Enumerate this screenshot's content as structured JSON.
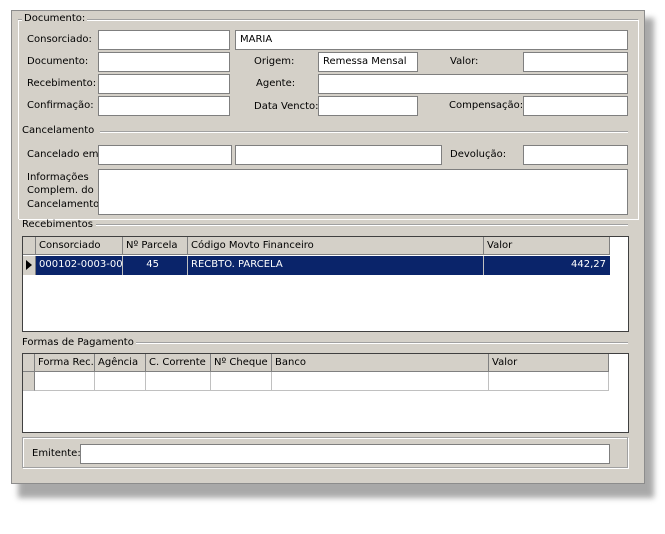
{
  "documento": {
    "title": "Documento:",
    "consorciado_label": "Consorciado:",
    "consorciado_code": "",
    "consorciado_name": "MARIA",
    "documento_label": "Documento:",
    "documento_value": "",
    "origem_label": "Origem:",
    "origem_value": "Remessa Mensal",
    "valor_label": "Valor:",
    "valor_value": "",
    "recebimento_label": "Recebimento:",
    "recebimento_value": "",
    "agente_label": "Agente:",
    "agente_value": "",
    "confirmacao_label": "Confirmação:",
    "confirmacao_value": "",
    "data_vencto_label": "Data Vencto:",
    "data_vencto_value": "",
    "compensacao_label": "Compensação:",
    "compensacao_value": ""
  },
  "cancelamento": {
    "title": "Cancelamento",
    "cancelado_em_label": "Cancelado em:",
    "cancelado_em_value": "",
    "cancelado_por_value": "",
    "devolucao_label": "Devolução:",
    "devolucao_value": "",
    "info_label_1": "Informações",
    "info_label_2": "Complem. do",
    "info_label_3": "Cancelamento:",
    "info_value": ""
  },
  "recebimentos": {
    "title": "Recebimentos",
    "columns": [
      "Consorciado",
      "Nº Parcela",
      "Código Movto Financeiro",
      "Valor"
    ],
    "rows": [
      {
        "consorciado": "000102-0003-00",
        "parcela": "45",
        "codigo": "RECBTO. PARCELA",
        "valor": "442,27"
      }
    ]
  },
  "formas_pagamento": {
    "title": "Formas de Pagamento",
    "columns": [
      "Forma Rec.",
      "Agência",
      "C. Corrente",
      "Nº Cheque",
      "Banco",
      "Valor"
    ]
  },
  "emitente": {
    "label": "Emitente:",
    "value": ""
  },
  "colors": {
    "window_bg": "#d4d0c8",
    "selected_row_bg": "#0a246a",
    "selected_row_text": "#ffffff"
  }
}
